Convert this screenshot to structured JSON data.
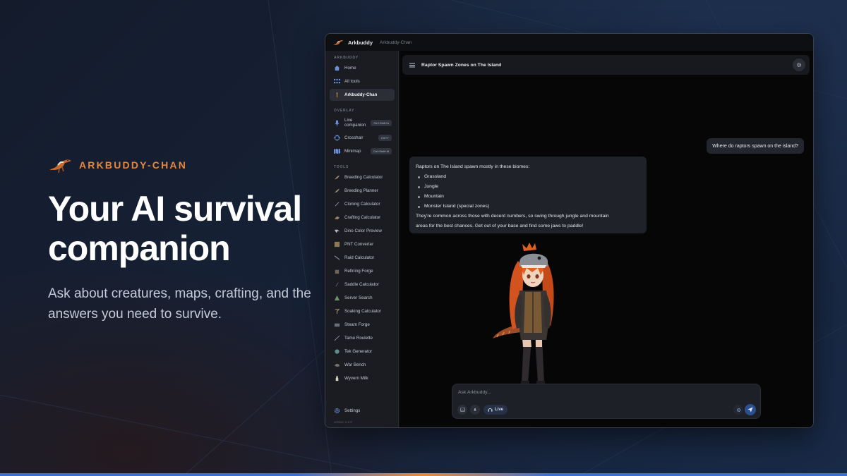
{
  "hero": {
    "brand": "ARKBUDDY-CHAN",
    "headline": "Your AI survival companion",
    "subline": "Ask about creatures, maps, crafting, and the answers you need to survive."
  },
  "window": {
    "app_name": "Arkbuddy",
    "app_subtitle": "Arkbuddy-Chan"
  },
  "sidebar": {
    "section_main": "ARKBUDDY",
    "main_items": [
      {
        "label": "Home",
        "icon": "home-icon"
      },
      {
        "label": "All tools",
        "icon": "grid-icon"
      },
      {
        "label": "Arkbuddy-Chan",
        "icon": "chat-icon",
        "active": true
      }
    ],
    "section_overlay": "OVERLAY",
    "overlay_items": [
      {
        "label": "Live companion",
        "label_line1": "Live",
        "label_line2": "companion",
        "shortcut": "Ctrl+Shift+A",
        "icon": "mic-icon"
      },
      {
        "label": "Crosshair",
        "shortcut": "Ctrl+Y",
        "icon": "crosshair-icon"
      },
      {
        "label": "Minimap",
        "shortcut": "Ctrl+Shift+M",
        "icon": "map-icon"
      }
    ],
    "section_tools": "TOOLS",
    "tool_items": [
      "Breeding Calculator",
      "Breeding Planner",
      "Cloning Calculator",
      "Crafting Calculator",
      "Dino Color Preview",
      "PNT Converter",
      "Raid Calculator",
      "Refining Forge",
      "Saddle Calculator",
      "Server Search",
      "Soaking Calculator",
      "Steam Forge",
      "Tame Roulette",
      "Tek Generator",
      "War Bench",
      "Wyvern Milk"
    ],
    "settings_label": "Settings",
    "version": "version 1.2.0"
  },
  "chat": {
    "title": "Raptor Spawn Zones on The Island",
    "user_message": "Where do raptors spawn on the island?",
    "bot_intro": "Raptors on The Island spawn mostly in these biomes:",
    "bot_list": [
      "Grassland",
      "Jungle",
      "Mountain",
      "Monster Island (special zones)"
    ],
    "bot_outro_line1": "They're common across those with decent numbers, so swing through jungle and mountain",
    "bot_outro_line2": "areas for the best chances. Get out of your base and find some jaws to paddle!",
    "placeholder": "Ask Arkbuddy...",
    "live_label": "Live"
  },
  "colors": {
    "accent_orange": "#e8863a",
    "accent_blue": "#3d6fd1",
    "send_blue": "#2c4f8d"
  }
}
